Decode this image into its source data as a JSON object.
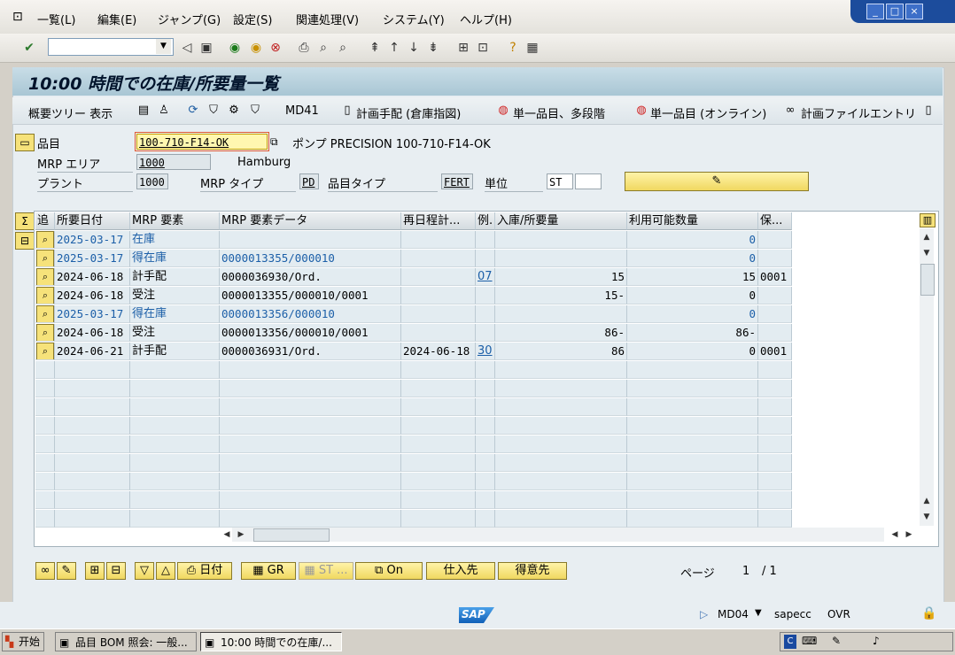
{
  "menu": {
    "items": [
      "一覧(L)",
      "編集(E)",
      "ジャンプ(G)",
      "設定(S)",
      "関連処理(V)",
      "システム(Y)",
      "ヘルプ(H)"
    ]
  },
  "window_buttons": [
    "_",
    "□",
    "×"
  ],
  "toolbar": {
    "command_value": "",
    "icons": [
      "check-icon",
      "back-icon",
      "save-icon",
      "back-green-icon",
      "exit-icon",
      "cancel-icon",
      "print-icon",
      "find-icon",
      "find-next-icon",
      "first-page-icon",
      "prev-page-icon",
      "next-page-icon",
      "last-page-icon",
      "new-session-icon",
      "shortcut-icon",
      "help-icon",
      "layout-icon"
    ]
  },
  "screen": {
    "title": "10:00 時間での在庫/所要量一覧"
  },
  "app_toolbar": {
    "overview_tree": "概要ツリー 表示",
    "md41": "MD41",
    "planning_list": "計画手配 (倉庫指図)",
    "single_item_multilevel": "単一品目、多段階",
    "single_item_online": "単一品目 (オンライン)",
    "planning_file_entry": "計画ファイルエントリ"
  },
  "header": {
    "material_label": "品目",
    "material_value": "100-710-F14-OK",
    "material_text": "ポンプ PRECISION 100-710-F14-OK",
    "mrp_area_label": "MRP エリア",
    "mrp_area_value": "1000",
    "mrp_area_text": "Hamburg",
    "plant_label": "プラント",
    "plant_value": "1000",
    "mrp_type_label": "MRP タイプ",
    "mrp_type_value": "PD",
    "material_type_label": "品目タイプ",
    "material_type_value": "FERT",
    "unit_label": "単位",
    "unit_value": "ST"
  },
  "table": {
    "columns": [
      "追",
      "所要日付",
      "MRP 要素",
      "MRP 要素データ",
      "再日程計...",
      "例.",
      "入庫/所要量",
      "利用可能数量",
      "保..."
    ],
    "rows": [
      {
        "date": "2025-03-17",
        "element": "在庫",
        "data": "",
        "resched": "",
        "exc": "",
        "qty": "",
        "avail": "0",
        "store": "",
        "blue": true
      },
      {
        "date": "2025-03-17",
        "element": "得在庫",
        "data": "0000013355/000010",
        "resched": "",
        "exc": "",
        "qty": "",
        "avail": "0",
        "store": "",
        "blue": true
      },
      {
        "date": "2024-06-18",
        "element": "計手配",
        "data": "0000036930/Ord.",
        "resched": "",
        "exc": "07",
        "qty": "15",
        "avail": "15",
        "store": "0001",
        "blue": false
      },
      {
        "date": "2024-06-18",
        "element": "受注",
        "data": "0000013355/000010/0001",
        "resched": "",
        "exc": "",
        "qty": "15-",
        "avail": "0",
        "store": "",
        "blue": false
      },
      {
        "date": "2025-03-17",
        "element": "得在庫",
        "data": "0000013356/000010",
        "resched": "",
        "exc": "",
        "qty": "",
        "avail": "0",
        "store": "",
        "blue": true
      },
      {
        "date": "2024-06-18",
        "element": "受注",
        "data": "0000013356/000010/0001",
        "resched": "",
        "exc": "",
        "qty": "86-",
        "avail": "86-",
        "store": "",
        "blue": false
      },
      {
        "date": "2024-06-21",
        "element": "計手配",
        "data": "0000036931/Ord.",
        "resched": "2024-06-18",
        "exc": "30",
        "qty": "86",
        "avail": "0",
        "store": "0001",
        "blue": false
      }
    ]
  },
  "buttons": {
    "date": "日付",
    "gr": "GR",
    "st": "ST ...",
    "on": "On",
    "vendor": "仕入先",
    "customer": "得意先"
  },
  "paging": {
    "label": "ページ",
    "current": "1",
    "total": "/ 1"
  },
  "status": {
    "transaction": "MD04",
    "server": "sapecc",
    "mode": "OVR",
    "logo": "SAP"
  },
  "taskbar": {
    "start": "开始",
    "tasks": [
      "品目 BOM 照会: 一般...",
      "10:00 時間での在庫/..."
    ]
  }
}
